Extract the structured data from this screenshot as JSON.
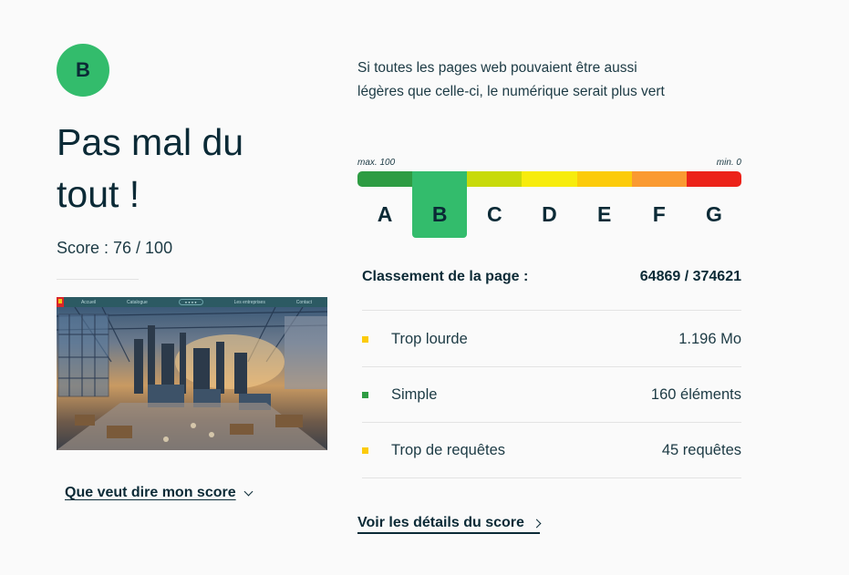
{
  "grade": {
    "letter": "B",
    "color": "#33bc6c"
  },
  "headline": "Pas mal du tout !",
  "score": "Score : 76 / 100",
  "thumbnail": {
    "nav_items": [
      "Accueil",
      "Catalogue",
      "Les entreprises",
      "Contact"
    ],
    "search_placeholder": "● ● ● ●"
  },
  "explain_link": "Que veut dire mon score",
  "intro": "Si toutes les pages web pouvaient être aussi légères que celle-ci, le numérique serait plus vert",
  "scale": {
    "max_label": "max. 100",
    "min_label": "min. 0",
    "grades": [
      {
        "letter": "A",
        "color": "#2e9c43"
      },
      {
        "letter": "B",
        "color": "#33bc6c"
      },
      {
        "letter": "C",
        "color": "#c8da0a"
      },
      {
        "letter": "D",
        "color": "#f7ec0c"
      },
      {
        "letter": "E",
        "color": "#fccb0a"
      },
      {
        "letter": "F",
        "color": "#fa9a31"
      },
      {
        "letter": "G",
        "color": "#ec2219"
      }
    ],
    "active": "B"
  },
  "ranking": {
    "label": "Classement de la page :",
    "value": "64869 / 374621"
  },
  "metrics": [
    {
      "label": "Trop lourde",
      "value": "1.196 Mo",
      "color": "#fccb0a"
    },
    {
      "label": "Simple",
      "value": "160 éléments",
      "color": "#2e9c43"
    },
    {
      "label": "Trop de requêtes",
      "value": "45 requêtes",
      "color": "#fccb0a"
    }
  ],
  "details_link": "Voir les détails du score"
}
